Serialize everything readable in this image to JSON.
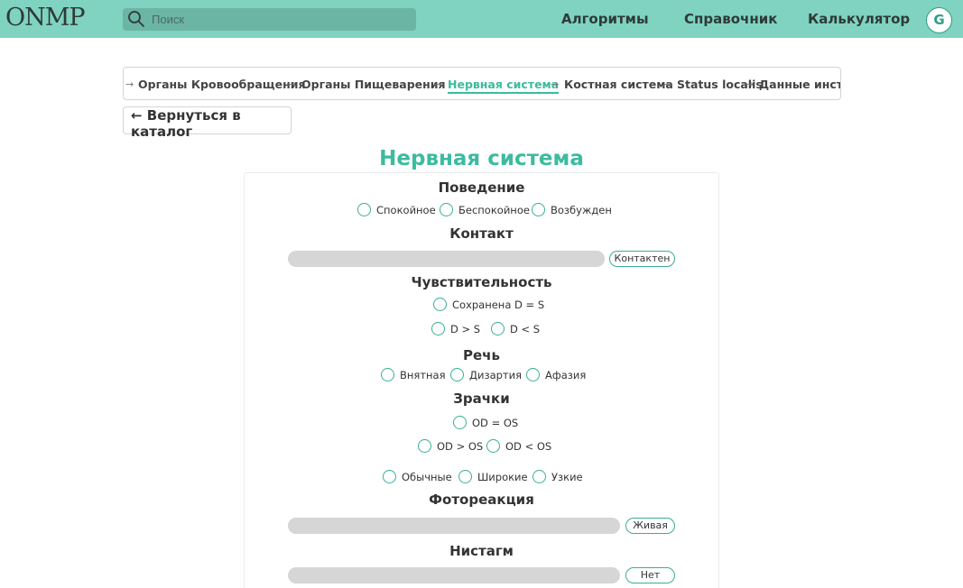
{
  "header": {
    "logo": "ONMP",
    "search_placeholder": "Поиск",
    "nav": [
      "Алгоритмы",
      "Справочник",
      "Калькулятор"
    ],
    "avatar_letter": "G"
  },
  "breadcrumbs": [
    "Органы Кровообращения",
    "Органы Пищеварения",
    "Нервная система",
    "Костная система",
    "Status localis",
    "Данные инст"
  ],
  "breadcrumb_active": "Нервная система",
  "back_button": "← Вернуться в каталог",
  "page_title": "Нервная система",
  "sections": {
    "behavior": {
      "title": "Поведение",
      "options": [
        "Спокойное",
        "Беспокойное",
        "Возбужден"
      ]
    },
    "contact": {
      "title": "Контакт",
      "value": "Контактен"
    },
    "sensitivity": {
      "title": "Чувствительность",
      "options": [
        "Сохранена D = S",
        "D > S",
        "D < S"
      ]
    },
    "speech": {
      "title": "Речь",
      "options": [
        "Внятная",
        "Дизартия",
        "Афазия"
      ]
    },
    "pupils": {
      "title": "Зрачки",
      "options_row1": [
        "OD = OS"
      ],
      "options_row2": [
        "OD > OS",
        "OD < OS"
      ],
      "options_row3": [
        "Обычные",
        "Широкие",
        "Узкие"
      ]
    },
    "photoreaction": {
      "title": "Фотореакция",
      "value": "Живая"
    },
    "nystagmus": {
      "title": "Нистагм",
      "value": "Нет"
    }
  },
  "colors": {
    "header_bg": "#7fd3c0",
    "accent": "#3dbb9f",
    "radio_border": "#3aae96"
  }
}
